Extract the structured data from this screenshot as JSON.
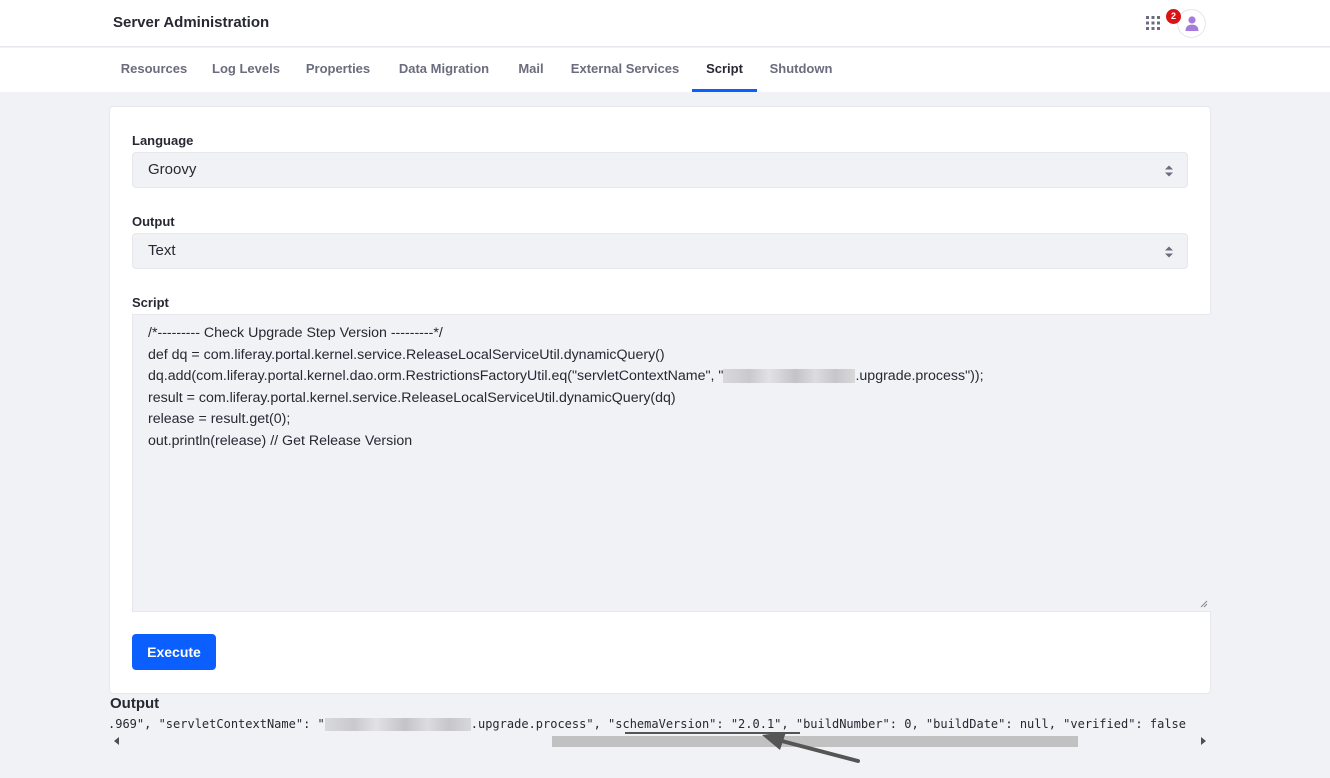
{
  "header": {
    "title": "Server Administration",
    "notification_count": "2",
    "icons": [
      "apps-grid-icon",
      "user-avatar-icon"
    ]
  },
  "tabs": [
    {
      "label": "Resources",
      "active": false
    },
    {
      "label": "Log Levels",
      "active": false
    },
    {
      "label": "Properties",
      "active": false
    },
    {
      "label": "Data Migration",
      "active": false
    },
    {
      "label": "Mail",
      "active": false
    },
    {
      "label": "External Services",
      "active": false
    },
    {
      "label": "Script",
      "active": true
    },
    {
      "label": "Shutdown",
      "active": false
    }
  ],
  "form": {
    "language_label": "Language",
    "language_value": "Groovy",
    "output_label": "Output",
    "output_value": "Text",
    "script_label": "Script",
    "script_lines": [
      "/*--------- Check Upgrade Step Version ---------*/",
      "def dq = com.liferay.portal.kernel.service.ReleaseLocalServiceUtil.dynamicQuery()",
      "dq.add(com.liferay.portal.kernel.dao.orm.RestrictionsFactoryUtil.eq(\"servletContextName\", \"",
      ".upgrade.process\"));",
      "result = com.liferay.portal.kernel.service.ReleaseLocalServiceUtil.dynamicQuery(dq)",
      "release = result.get(0);",
      "out.println(release) // Get Release Version"
    ],
    "execute_label": "Execute"
  },
  "output": {
    "title": "Output",
    "text_before": ".969\", \"servletContextName\": \"",
    "text_after": ".upgrade.process\", \"schemaVersion\": \"2.0.1\", \"buildNumber\": 0, \"buildDate\": null, \"verified\": false"
  },
  "colors": {
    "primary": "#0b5fff",
    "badge": "#da1414",
    "page_bg": "#f1f2f5"
  }
}
